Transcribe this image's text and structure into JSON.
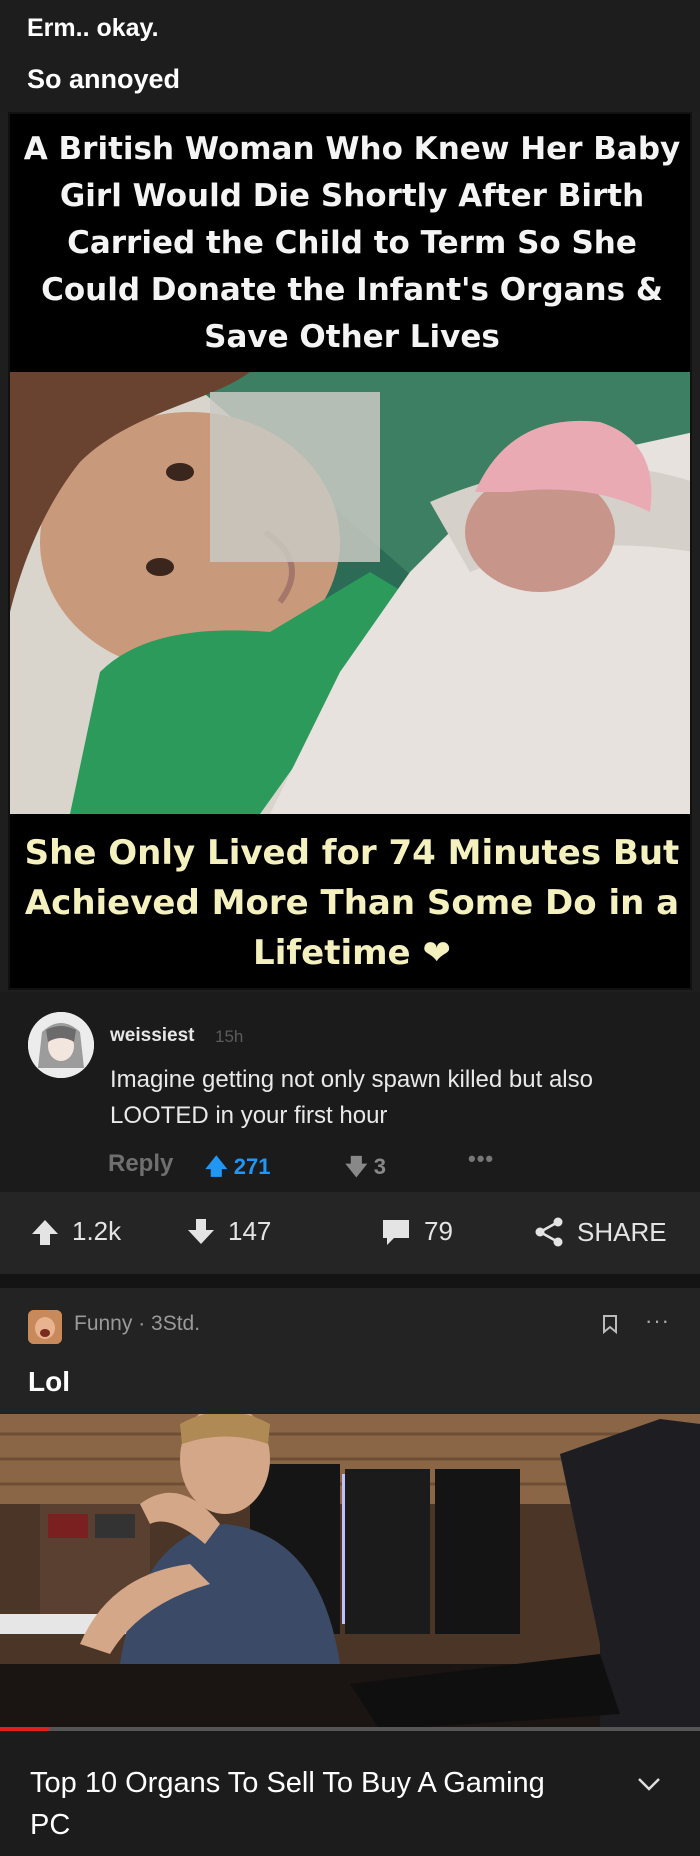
{
  "post1": {
    "subtitle": "Erm.. okay.",
    "title": "So annoyed",
    "meme": {
      "headline": "A British Woman Who Knew Her Baby Girl Would Die Shortly After Birth Carried the Child to Term So She Could Donate the Infant's Organs & Save Other Lives",
      "caption": "She Only Lived for 74 Minutes But Achieved More Than Some Do in a Lifetime",
      "heart": "❤"
    },
    "comment": {
      "username": "weissiest",
      "time": "15h",
      "text": "Imagine getting not only spawn killed but also LOOTED in your first hour",
      "reply_label": "Reply",
      "upvotes": "271",
      "downvotes": "3",
      "more": "•••"
    },
    "actions": {
      "upvotes": "1.2k",
      "downvotes": "147",
      "comments": "79",
      "share_label": "SHARE"
    }
  },
  "post2": {
    "meta": "Funny · 3Std.",
    "more": "···",
    "title": "Lol",
    "video_title": "Top 10 Organs To Sell To Buy A Gaming PC",
    "progress": 0.07,
    "progress_color": "#e02020"
  },
  "colors": {
    "upvote_blue": "#2196f3",
    "meme_caption": "#f4f1bf",
    "heart": "#d8232a"
  }
}
